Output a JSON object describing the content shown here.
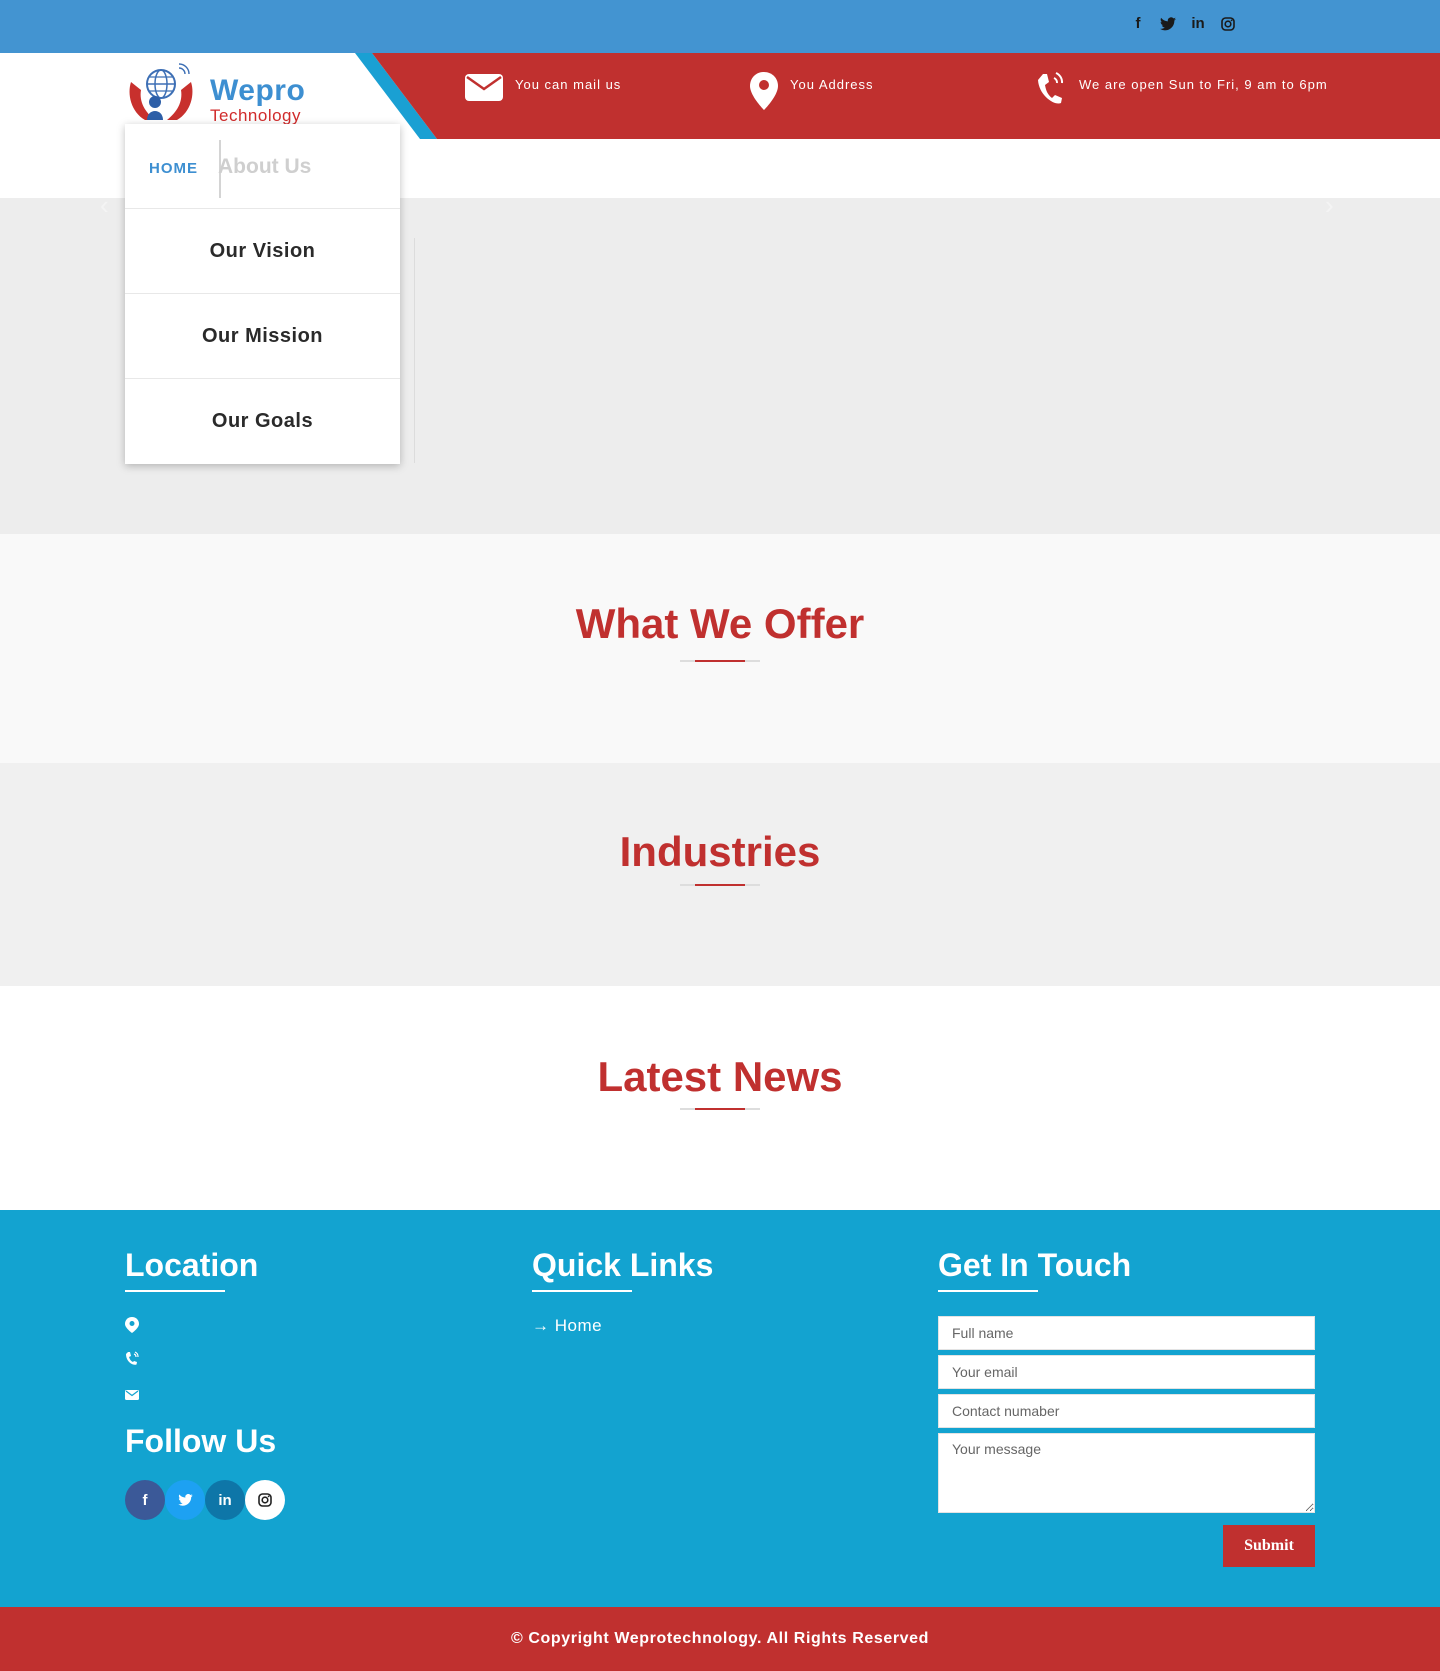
{
  "colors": {
    "topbar": "#4394d1",
    "brand_red": "#c0302f",
    "footer_blue": "#13a3d0",
    "nav_blue": "#3d8fd1"
  },
  "topbar": {
    "social": [
      "facebook-icon",
      "twitter-icon",
      "linkedin-icon",
      "instagram-icon"
    ]
  },
  "logo": {
    "title": "Wepro",
    "subtitle": "Technology"
  },
  "contacts": {
    "mail": "You can mail us",
    "address": "You Address",
    "hours": "We are open Sun to Fri, 9 am to 6pm"
  },
  "nav": {
    "home": "HOME",
    "about": "About Us",
    "dropdown": [
      "Our Vision",
      "Our Mission",
      "Our Goals"
    ]
  },
  "sections": {
    "offer": "What We Offer",
    "industries": "Industries",
    "news": "Latest News"
  },
  "footer": {
    "location_title": "Location",
    "quick_links_title": "Quick Links",
    "quick_links": [
      "Home"
    ],
    "get_in_touch_title": "Get In Touch",
    "follow_title": "Follow Us",
    "form": {
      "name_placeholder": "Full name",
      "email_placeholder": "Your email",
      "contact_placeholder": "Contact numaber",
      "message_placeholder": "Your message",
      "submit": "Submit"
    },
    "social_colors": {
      "facebook": "#3b5998",
      "twitter": "#1da1f2",
      "linkedin": "#0e76a8",
      "instagram": "#ffffff"
    }
  },
  "copyright": "© Copyright Weprotechnology. All Rights Reserved"
}
